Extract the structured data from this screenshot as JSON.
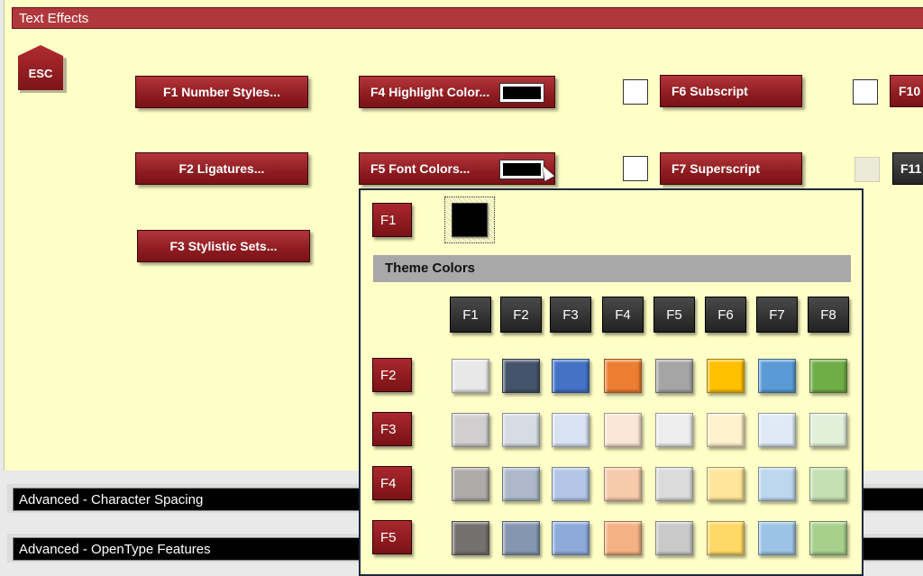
{
  "title_bar": {
    "label": "Text Effects"
  },
  "esc": {
    "label": "ESC"
  },
  "buttons": {
    "number_styles": "F1 Number Styles...",
    "ligatures": "F2 Ligatures...",
    "stylistic_sets": "F3 Stylistic Sets...",
    "highlight_color": "F4 Highlight Color...",
    "font_colors": "F5 Font Colors...",
    "subscript": "F6 Subscript",
    "superscript": "F7 Superscript",
    "f10": "F10",
    "f11": "F11"
  },
  "popup": {
    "current_key": "F1",
    "current_color": "#000000",
    "theme_header": "Theme Colors",
    "column_keys": [
      "F1",
      "F2",
      "F3",
      "F4",
      "F5",
      "F6",
      "F7",
      "F8"
    ],
    "row_keys": [
      "F2",
      "F3",
      "F4",
      "F5"
    ],
    "rows": [
      [
        "#e8e8e8",
        "#44546a",
        "#4472c4",
        "#ed7d31",
        "#a5a5a5",
        "#ffc000",
        "#5b9bd5",
        "#70ad47"
      ],
      [
        "#d0cece",
        "#d6dce4",
        "#d9e2f3",
        "#fbe5d5",
        "#ededed",
        "#fff2cc",
        "#deebf6",
        "#e2efd9"
      ],
      [
        "#aeaaaa",
        "#adb9ca",
        "#b4c6e7",
        "#f7caac",
        "#dbdbdb",
        "#fee599",
        "#bdd7ee",
        "#c5e0b3"
      ],
      [
        "#757070",
        "#8496b0",
        "#8eaadb",
        "#f4b183",
        "#c9c9c9",
        "#ffd965",
        "#9cc3e5",
        "#a8d08d"
      ]
    ]
  },
  "sections": {
    "char_spacing": "Advanced - Character Spacing",
    "opentype": "Advanced - OpenType Features"
  },
  "colors": {
    "accent_red": "#9a2227",
    "panel_bg": "#ffffc8",
    "title_bar_bg": "#b0383d"
  }
}
